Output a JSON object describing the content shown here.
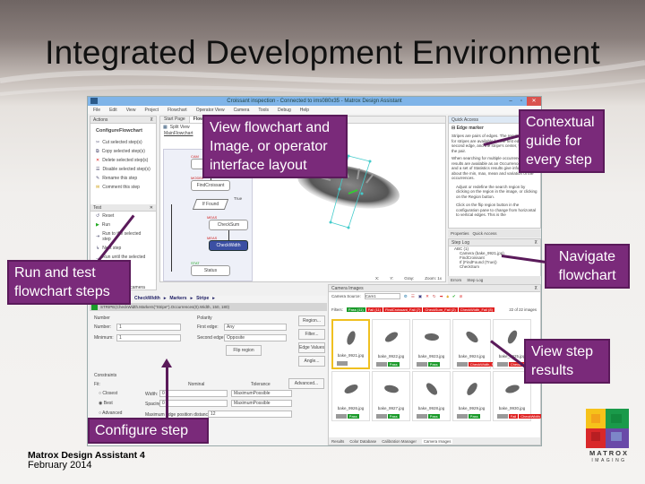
{
  "slide": {
    "title": "Integrated Development Environment",
    "footer_product": "Matrox Design Assistant 4",
    "footer_date": "February 2014",
    "logo_brand": "MATROX",
    "logo_sub": "IMAGING"
  },
  "callouts": {
    "view_flowchart": [
      "View flowchart and",
      "Image, or operator",
      "interface layout"
    ],
    "contextual": [
      "Contextual",
      "guide for",
      "every step"
    ],
    "navigate": [
      "Navigate",
      "flowchart"
    ],
    "run_test": [
      "Run and test",
      "flowchart steps"
    ],
    "view_results": [
      "View step",
      "results"
    ],
    "configure": [
      "Configure step"
    ]
  },
  "app": {
    "window_title": "Croissant inspection - Connected to ims080x35 - Matrox Design Assistant",
    "menu": [
      "File",
      "Edit",
      "View",
      "Project",
      "Flowchart",
      "Operator View",
      "Camera",
      "Tools",
      "Debug",
      "Help"
    ],
    "actions_panel": {
      "title": "Actions",
      "section": "ConfigureFlowchart",
      "items": [
        "Cut selected step(s)",
        "Copy selected step(s)",
        "Delete selected step(s)",
        "Disable selected step(s)",
        "Rename this step",
        "Comment this step"
      ]
    },
    "run_panel": {
      "title": "Test",
      "items": [
        "Reset",
        "Run",
        "Run to the selected step",
        "Next step",
        "Run until the selected step"
      ]
    },
    "other_panel_item": "Run using the camera",
    "tabs": [
      "Start Page",
      "Flowchart"
    ],
    "split_view": "Split View",
    "flowchart_name": "MainFlowchart",
    "flowchart_steps": [
      {
        "label": "Camera",
        "tag": "CAM"
      },
      {
        "label": "FindCroissant",
        "tag": "MODEL"
      },
      {
        "label": "If Found",
        "tag": ""
      },
      {
        "label": "CheckSum",
        "tag": "MEAS"
      },
      {
        "label": "CheckWidth",
        "tag": "MEAS",
        "selected": true
      },
      {
        "label": "Status",
        "tag": "STAT"
      }
    ],
    "flowchart_true_label": "True",
    "image_status": {
      "x": "X:",
      "y": "Y:",
      "gray": "Gray:",
      "zoom": "Zoom: 1x"
    },
    "quick_access": {
      "title": "Quick Access",
      "section": "Edge marker",
      "paragraph1": "Stripes are pairs of edges. The results returned for stripes are available for the first edge, second edge, and the stripe's center, width and the pair.",
      "paragraph2": "When searching for multiple occurrences, results are available as an Occurrence array and a set of Statistics results give information about the min, max, mean and variation of the occurrences.",
      "list": [
        "Adjust or redefine the search region by clicking on the region in the image, or clicking on the Region button.",
        "Click on the flip region button in the configuration pane to change from horizontal to vertical edges. This is the"
      ],
      "tabs": [
        "Properties",
        "Quick Access"
      ]
    },
    "step_log": {
      "title": "Step Log",
      "root": "ABC (1)",
      "items": [
        "Camera (bake_9921.jpg)",
        "FindCroissant",
        "If (FindFound (True))",
        "CheckSum",
        "CheckWidth"
      ],
      "tabs": [
        "Errors",
        "Step Log"
      ]
    },
    "breadcrumb": [
      "CheckWidth",
      "Markers",
      "Stripe"
    ],
    "expression": "STRIPE(CheckWidth.Markers(\"Stripe\").Occurrences(0).Width, 150, 180)",
    "config": {
      "number_group": "Number",
      "number_label": "Number:",
      "number_value": "1",
      "min_label": "Minimum:",
      "min_value": "1",
      "polarity_group": "Polarity",
      "first_edge_label": "First edge:",
      "first_edge_value": "Any",
      "second_edge_label": "Second edge:",
      "second_edge_value": "Opposite",
      "flip_button": "Flip region",
      "buttons": [
        "Region...",
        "Filter...",
        "Edge Values",
        "Angle..."
      ],
      "constraints_group": "Constraints",
      "fit_label": "Fit:",
      "fit_options": [
        "Closest",
        "Best",
        "Advanced"
      ],
      "fit_selected": "Best",
      "col_nominal": "Nominal",
      "col_tolerance": "Tolerance",
      "advanced_button": "Advanced...",
      "width_label": "Width:",
      "width_value": "0",
      "width_tol": "MaximumPossible",
      "spacing_label": "Spacing:",
      "spacing_value": "0",
      "spacing_tol": "MaximumPossible",
      "max_edge_label": "Maximum edge position distance:",
      "max_edge_value": "12"
    },
    "camera_images": {
      "title": "Camera Images",
      "source_label": "Camera Source:",
      "source_value": "Cam1",
      "filters_label": "Filters:",
      "filters": [
        {
          "label": "Pass (11)",
          "status": "pass"
        },
        {
          "label": "Fail (11)",
          "status": "fail"
        },
        {
          "label": "FindCroissant_Fail (7)",
          "status": "fail"
        },
        {
          "label": "CheckSum_Fail (2)",
          "status": "fail"
        },
        {
          "label": "CheckWidth_Fail (8)",
          "status": "fail"
        }
      ],
      "count": "22 of 22 images",
      "thumbnails": [
        {
          "file": "bake_9921.jpg",
          "status": "selected",
          "badges": []
        },
        {
          "file": "bake_9922.jpg",
          "status": "pass",
          "badges": [
            "Pass"
          ]
        },
        {
          "file": "bake_9923.jpg",
          "status": "pass",
          "badges": [
            "Pass"
          ]
        },
        {
          "file": "bake_9924.jpg",
          "status": "fail",
          "badges": [
            "CheckWidth_Fail"
          ]
        },
        {
          "file": "bake_9925.jpg",
          "status": "fail",
          "badges": [
            "CheckWidth_Fail"
          ]
        },
        {
          "file": "bake_9926.jpg",
          "status": "pass",
          "badges": [
            "Pass"
          ]
        },
        {
          "file": "bake_9927.jpg",
          "status": "pass",
          "badges": [
            "Pass"
          ]
        },
        {
          "file": "bake_9928.jpg",
          "status": "pass",
          "badges": [
            "Pass"
          ]
        },
        {
          "file": "bake_9929.jpg",
          "status": "pass",
          "badges": [
            "Pass"
          ]
        },
        {
          "file": "bake_9930.jpg",
          "status": "fail",
          "badges": [
            "Fail",
            "CheckWidth_Fail"
          ]
        }
      ],
      "bottom_tabs": [
        "Results",
        "Color Database",
        "Calibration Manager",
        "Camera Images"
      ]
    }
  },
  "colors": {
    "callout_bg": "#7a2a7a",
    "titlebar": "#7fb4e8",
    "pass": "#1a9a2a",
    "fail": "#e02020",
    "selected_step": "#3b4fa3"
  }
}
